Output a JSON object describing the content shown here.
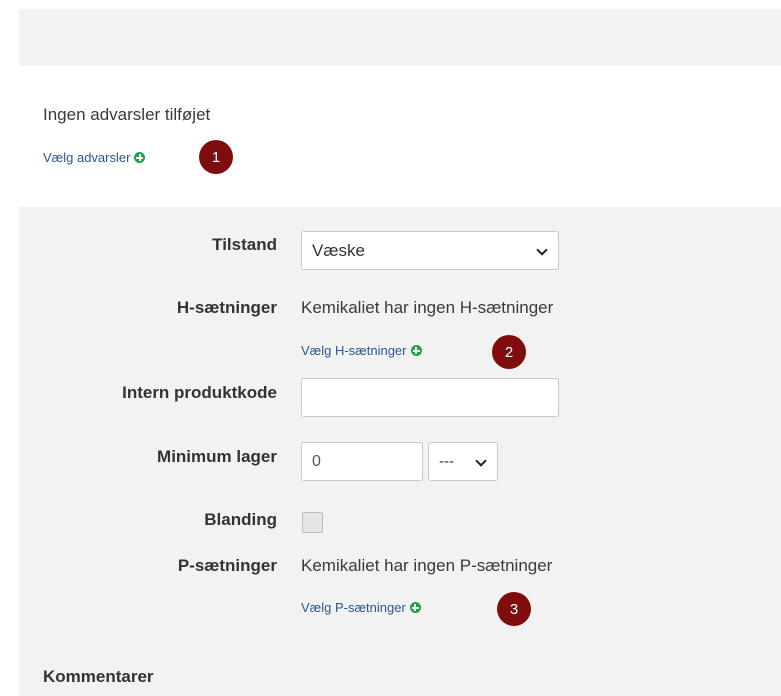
{
  "warnings": {
    "empty_text": "Ingen advarsler tilføjet",
    "pick_label": "Vælg advarsler",
    "badge": "1"
  },
  "form": {
    "state": {
      "label": "Tilstand",
      "value": "Væske"
    },
    "h_phrases": {
      "label": "H-sætninger",
      "empty_text": "Kemikaliet har ingen H-sætninger",
      "pick_label": "Vælg H-sætninger",
      "badge": "2"
    },
    "internal_code": {
      "label": "Intern produktkode",
      "value": ""
    },
    "min_stock": {
      "label": "Minimum lager",
      "value": "0",
      "unit": "---"
    },
    "mixture": {
      "label": "Blanding",
      "checked": false
    },
    "p_phrases": {
      "label": "P-sætninger",
      "empty_text": "Kemikaliet har ingen P-sætninger",
      "pick_label": "Vælg P-sætninger",
      "badge": "3"
    }
  },
  "comments": {
    "heading": "Kommentarer"
  },
  "colors": {
    "link": "#2e5592",
    "plus": "#1fa24a",
    "badge": "#800d0d",
    "panel": "#f2f2f2"
  }
}
